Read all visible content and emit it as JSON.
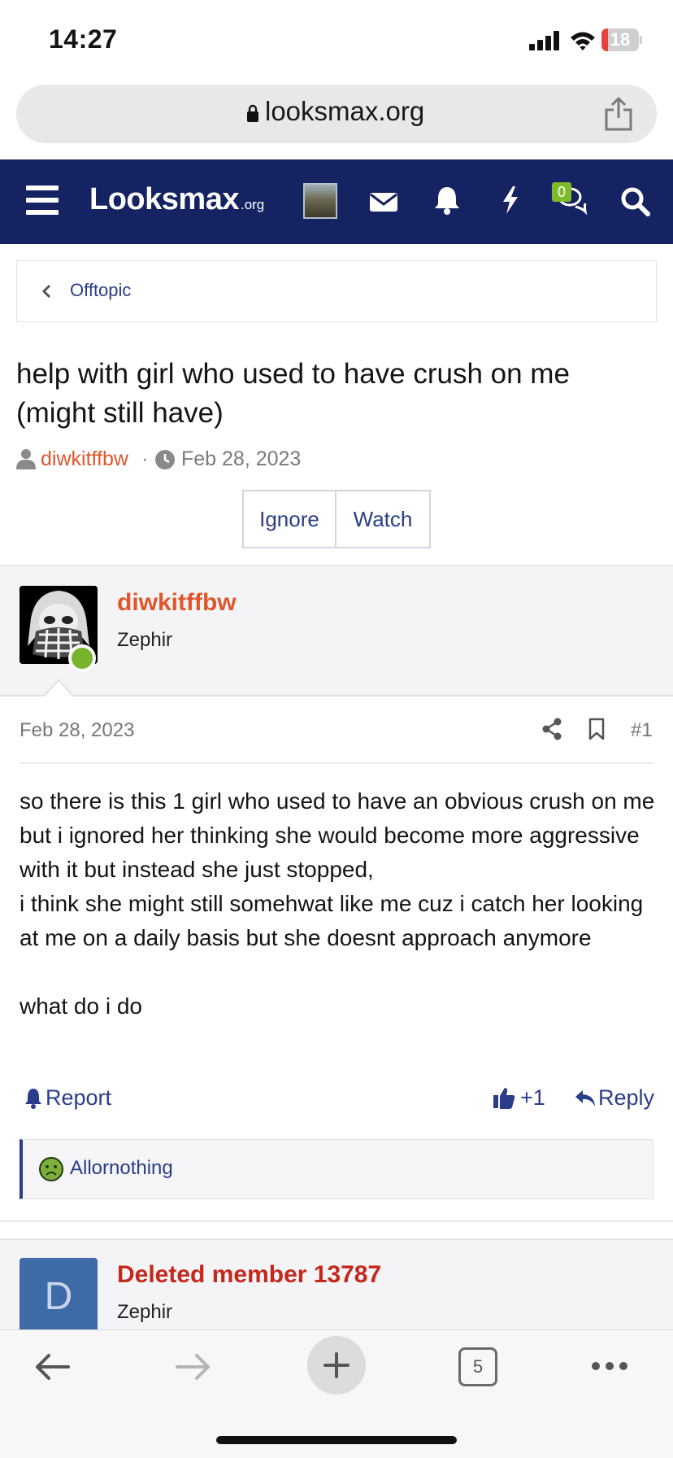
{
  "status_bar": {
    "time": "14:27",
    "battery": "18",
    "battery_level": 0.18
  },
  "browser": {
    "url": "looksmax.org",
    "open_tabs": "5"
  },
  "nav": {
    "logo_main": "Looksmax",
    "logo_suffix": ".org",
    "conversations_badge": "0",
    "icons": [
      "menu-icon",
      "avatar",
      "mail-icon",
      "bell-icon",
      "lightning-icon",
      "chat-icon",
      "search-icon"
    ]
  },
  "breadcrumb": {
    "label": "Offtopic"
  },
  "thread": {
    "title": "help with girl who used to have crush on me (might still have)",
    "author": "diwkitffbw",
    "separator": "·",
    "date": "Feb 28, 2023",
    "buttons": {
      "ignore": "Ignore",
      "watch": "Watch"
    }
  },
  "post": {
    "username": "diwkitffbw",
    "role": "Zephir",
    "date": "Feb 28, 2023",
    "number": "#1",
    "body_lines": [
      "so there is this 1 girl who used to have an obvious crush on me but i ignored her thinking she would become more aggressive with it but instead she just stopped,",
      "i think she might still somehwat like me cuz i catch her looking at me on a daily basis but she doesnt approach anymore",
      "what do i do"
    ],
    "actions": {
      "report": "Report",
      "likes": "+1",
      "reply": "Reply"
    },
    "reaction_user": "Allornothing"
  },
  "post2": {
    "avatar_letter": "D",
    "username": "Deleted member 13787",
    "role": "Zephir"
  },
  "colors": {
    "nav_bg": "#152363",
    "link": "#2a3d8a",
    "username": "#e0562c",
    "deleted_username": "#c4271b",
    "online": "#77b32c"
  }
}
